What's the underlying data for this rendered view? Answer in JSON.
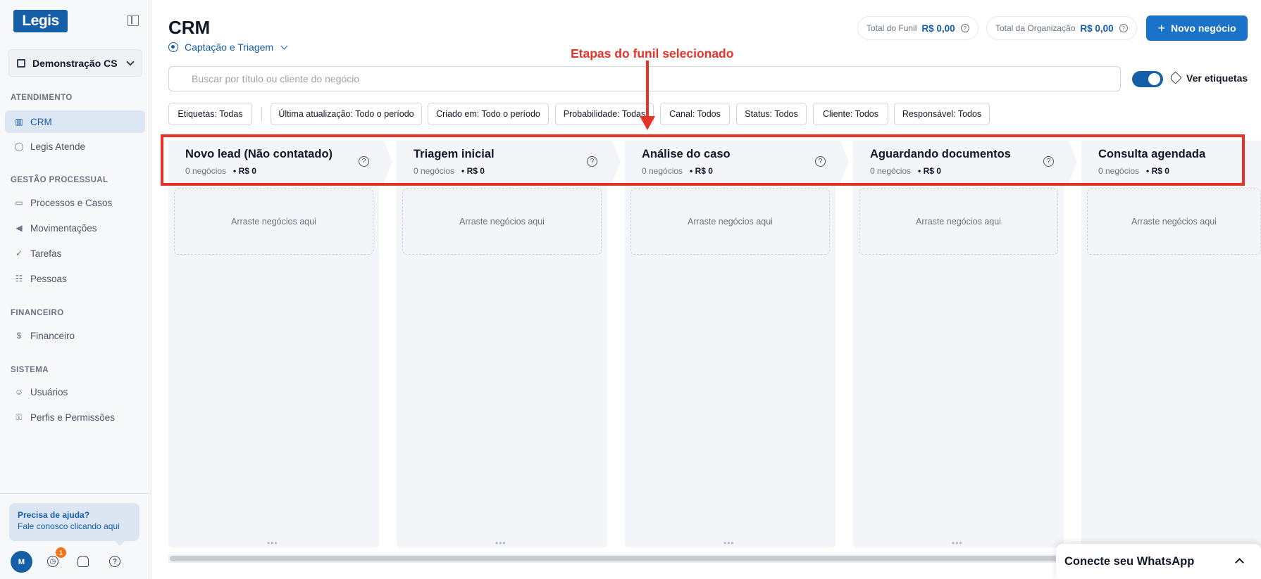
{
  "sidebar": {
    "logo": "Legis",
    "organization": "Demonstração CS",
    "sections": [
      {
        "title": "ATENDIMENTO",
        "items": [
          {
            "label": "CRM",
            "icon": "kanban-icon",
            "active": true
          },
          {
            "label": "Legis Atende",
            "icon": "whatsapp-icon"
          }
        ]
      },
      {
        "title": "GESTÃO PROCESSUAL",
        "items": [
          {
            "label": "Processos e Casos",
            "icon": "folder-icon"
          },
          {
            "label": "Movimentações",
            "icon": "megaphone-icon"
          },
          {
            "label": "Tarefas",
            "icon": "check-circle-icon"
          },
          {
            "label": "Pessoas",
            "icon": "people-icon"
          }
        ]
      },
      {
        "title": "FINANCEIRO",
        "items": [
          {
            "label": "Financeiro",
            "icon": "dollar-icon"
          }
        ]
      },
      {
        "title": "SISTEMA",
        "items": [
          {
            "label": "Usuários",
            "icon": "user-icon"
          },
          {
            "label": "Perfis e Permissões",
            "icon": "key-icon"
          }
        ]
      }
    ],
    "help": {
      "title": "Precisa de ajuda?",
      "subtitle": "Fale conosco clicando aqui"
    },
    "footer": {
      "avatar": "M",
      "notification_count": "1"
    }
  },
  "header": {
    "title": "CRM",
    "funnel": "Captação e Triagem",
    "total_funnel_label": "Total do Funil",
    "total_funnel_value": "R$ 0,00",
    "total_org_label": "Total da Organização",
    "total_org_value": "R$ 0,00",
    "new_button": "Novo negócio"
  },
  "annotation": "Etapas do funil selecionado",
  "search": {
    "placeholder": "Buscar por título ou cliente do negócio"
  },
  "tags_toggle": {
    "label": "Ver etiquetas",
    "on": true
  },
  "filters": [
    "Etiquetas: Todas",
    "Última atualização: Todo o período",
    "Criado em: Todo o período",
    "Probabilidade: Todas",
    "Canal: Todos",
    "Status: Todos",
    "Cliente: Todos",
    "Responsável: Todos"
  ],
  "stages": [
    {
      "title": "Novo lead (Não contatado)",
      "count": "0 negócios",
      "value": "• R$ 0",
      "drop": "Arraste negócios aqui"
    },
    {
      "title": "Triagem inicial",
      "count": "0 negócios",
      "value": "• R$ 0",
      "drop": "Arraste negócios aqui"
    },
    {
      "title": "Análise do caso",
      "count": "0 negócios",
      "value": "• R$ 0",
      "drop": "Arraste negócios aqui"
    },
    {
      "title": "Aguardando documentos",
      "count": "0 negócios",
      "value": "• R$ 0",
      "drop": "Arraste negócios aqui"
    },
    {
      "title": "Consulta agendada",
      "count": "0 negócios",
      "value": "• R$ 0",
      "drop": "Arraste negócios aqui"
    }
  ],
  "whatsapp_panel": {
    "label": "Conecte seu WhatsApp"
  },
  "colors": {
    "brand": "#155ea8",
    "primary_button": "#1a73c8",
    "annotation": "#e63329"
  }
}
